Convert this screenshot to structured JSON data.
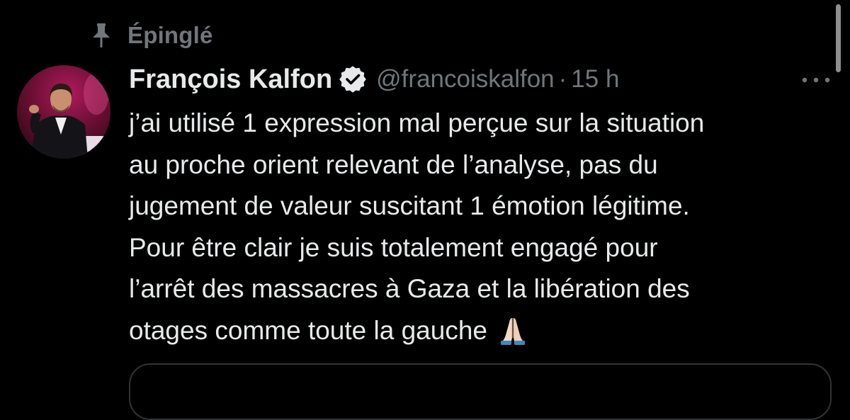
{
  "pinned": {
    "label": "Épinglé",
    "icon": "pin-icon"
  },
  "tweet": {
    "author_name": "François Kalfon",
    "verified_icon": "verified-badge-icon",
    "handle": "@francoiskalfon",
    "separator": "·",
    "time": "15 h",
    "more_icon": "more-options-icon",
    "lines": [
      "j’ai utilisé 1 expression mal perçue sur la situation",
      "au proche orient relevant de l’analyse, pas du",
      "jugement de valeur suscitant 1 émotion légitime.",
      "Pour être clair  je suis totalement engagé pour",
      "l’arrêt des massacres à Gaza et la libération des",
      "otages comme toute la gauche"
    ],
    "emoji": "folded-hands-emoji"
  },
  "colors": {
    "background": "#000000",
    "text_primary": "#e7e9ea",
    "text_secondary": "#71767b",
    "border": "#2f3336"
  }
}
